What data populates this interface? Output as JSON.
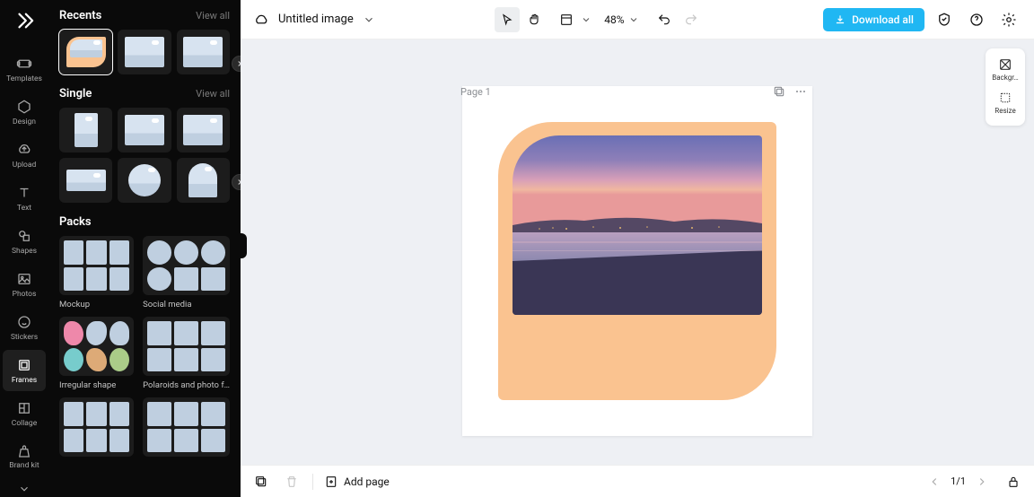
{
  "rail": {
    "items": [
      {
        "label": "Templates"
      },
      {
        "label": "Design"
      },
      {
        "label": "Upload"
      },
      {
        "label": "Text"
      },
      {
        "label": "Shapes"
      },
      {
        "label": "Photos"
      },
      {
        "label": "Stickers"
      },
      {
        "label": "Frames"
      },
      {
        "label": "Collage"
      },
      {
        "label": "Brand kit"
      }
    ]
  },
  "panel": {
    "sections": {
      "recents": {
        "title": "Recents",
        "view_all": "View all"
      },
      "single": {
        "title": "Single",
        "view_all": "View all"
      },
      "packs": {
        "title": "Packs"
      }
    },
    "packs": [
      {
        "label": "Mockup"
      },
      {
        "label": "Social media"
      },
      {
        "label": "Irregular shape"
      },
      {
        "label": "Polaroids and photo f…"
      }
    ]
  },
  "topbar": {
    "doc_title": "Untitled image",
    "zoom": "48%",
    "download_label": "Download all"
  },
  "side_tools": {
    "background": "Backgr…",
    "resize": "Resize"
  },
  "canvas": {
    "page_label": "Page 1",
    "frame_color": "#fac390"
  },
  "bottom": {
    "add_page": "Add page",
    "pager": "1/1"
  }
}
